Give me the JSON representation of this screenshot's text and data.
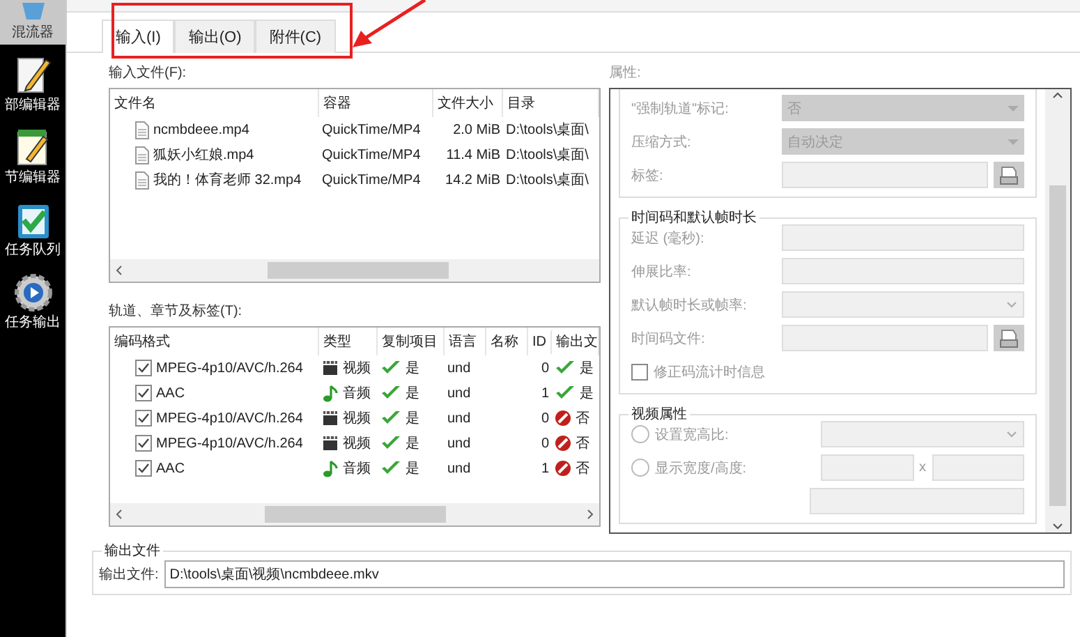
{
  "sidebar": {
    "items": [
      {
        "kind": "mixer",
        "label": "混流器",
        "selected": true
      },
      {
        "kind": "header",
        "label": "部编辑器",
        "selected": false
      },
      {
        "kind": "chapter",
        "label": "节编辑器",
        "selected": false
      },
      {
        "kind": "queue",
        "label": "任务队列",
        "selected": false
      },
      {
        "kind": "output",
        "label": "任务输出",
        "selected": false
      }
    ]
  },
  "tabs": [
    {
      "label": "输入(I)",
      "selected": true
    },
    {
      "label": "输出(O)",
      "selected": false
    },
    {
      "label": "附件(C)",
      "selected": false
    }
  ],
  "input_files": {
    "label": "输入文件(F):",
    "columns": [
      "文件名",
      "容器",
      "文件大小",
      "目录"
    ],
    "rows": [
      {
        "name": "ncmbdeee.mp4",
        "container": "QuickTime/MP4",
        "size": "2.0 MiB",
        "directory": "D:\\tools\\桌面\\"
      },
      {
        "name": "狐妖小红娘.mp4",
        "container": "QuickTime/MP4",
        "size": "11.4 MiB",
        "directory": "D:\\tools\\桌面\\"
      },
      {
        "name": "我的！体育老师 32.mp4",
        "container": "QuickTime/MP4",
        "size": "14.2 MiB",
        "directory": "D:\\tools\\桌面\\"
      }
    ]
  },
  "tracks": {
    "label": "轨道、章节及标签(T):",
    "columns": [
      "编码格式",
      "类型",
      "复制项目",
      "语言",
      "名称",
      "ID",
      "输出文"
    ],
    "rows": [
      {
        "checked": true,
        "codec": "MPEG-4p10/AVC/h.264",
        "kind": "video",
        "type": "视频",
        "copy": "是",
        "language": "und",
        "id": "0",
        "output": true,
        "output_text": "是"
      },
      {
        "checked": true,
        "codec": "AAC",
        "kind": "audio",
        "type": "音频",
        "copy": "是",
        "language": "und",
        "id": "1",
        "output": true,
        "output_text": "是"
      },
      {
        "checked": true,
        "codec": "MPEG-4p10/AVC/h.264",
        "kind": "video",
        "type": "视频",
        "copy": "是",
        "language": "und",
        "id": "0",
        "output": false,
        "output_text": "否"
      },
      {
        "checked": true,
        "codec": "MPEG-4p10/AVC/h.264",
        "kind": "video",
        "type": "视频",
        "copy": "是",
        "language": "und",
        "id": "0",
        "output": false,
        "output_text": "否"
      },
      {
        "checked": true,
        "codec": "AAC",
        "kind": "audio",
        "type": "音频",
        "copy": "是",
        "language": "und",
        "id": "1",
        "output": false,
        "output_text": "否"
      }
    ]
  },
  "properties": {
    "label": "属性:",
    "groups": [
      {
        "rows": [
          {
            "kind": "select",
            "label": "\"强制轨道\"标记:",
            "value": "否"
          },
          {
            "kind": "select",
            "label": "压缩方式:",
            "value": "自动决定"
          },
          {
            "kind": "browse",
            "label": "标签:"
          }
        ]
      },
      {
        "title": "时间码和默认帧时长",
        "rows": [
          {
            "kind": "text",
            "label": "延迟 (毫秒):"
          },
          {
            "kind": "text",
            "label": "伸展比率:"
          },
          {
            "kind": "combo",
            "label": "默认帧时长或帧率:"
          },
          {
            "kind": "browse",
            "label": "时间码文件:"
          },
          {
            "kind": "checkbox",
            "label": "修正码流计时信息",
            "checked": false
          }
        ]
      },
      {
        "title": "视频属性",
        "rows": [
          {
            "kind": "radio-combo",
            "label": "设置宽高比:",
            "selected": false
          },
          {
            "kind": "radio-pair",
            "label": "显示宽度/高度:",
            "selected": false,
            "separator": "x"
          },
          {
            "kind": "cut"
          }
        ]
      }
    ]
  },
  "output_file": {
    "legend": "输出文件",
    "label": "输出文件:",
    "value": "D:\\tools\\桌面\\视频\\ncmbdeee.mkv"
  }
}
